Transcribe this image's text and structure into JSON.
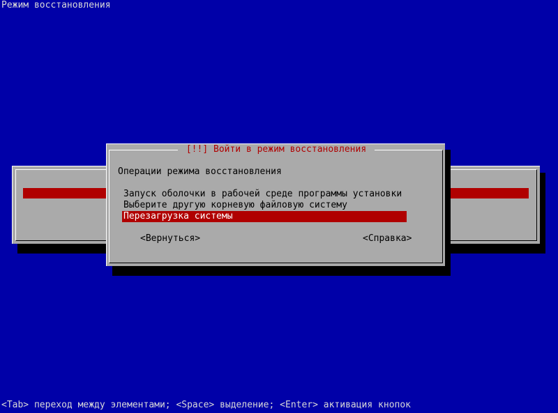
{
  "screen": {
    "title": "Режим восстановления",
    "footer_hint": "<Tab> переход между элементами; <Space> выделение; <Enter> активация кнопок"
  },
  "dialog": {
    "title": "[!!] Войти в режим восстановления",
    "prompt": "Операции режима восстановления",
    "menu_items": [
      {
        "label": "Запуск оболочки в рабочей среде программы установки",
        "selected": false
      },
      {
        "label": "Выберите другую корневую файловую систему",
        "selected": false
      },
      {
        "label": "Перезагрузка системы",
        "selected": true
      }
    ],
    "buttons": {
      "back_label": "<Вернуться>",
      "help_label": "<Справка>"
    }
  },
  "colors": {
    "background": "#0000a8",
    "dialog": "#aaaaaa",
    "selection": "#b00000",
    "title_text": "#b00000",
    "screen_text": "#d8d8d8"
  }
}
